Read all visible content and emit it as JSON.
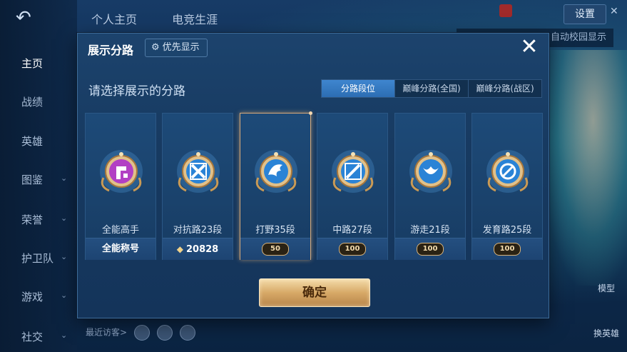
{
  "top_tabs": [
    "个人主页",
    "电竞生涯"
  ],
  "settings_label": "设置",
  "right_banner_text": "自动校园显示",
  "side_nav": [
    {
      "label": "主页",
      "has_chevron": false,
      "active": true
    },
    {
      "label": "战绩",
      "has_chevron": false,
      "active": false
    },
    {
      "label": "英雄",
      "has_chevron": false,
      "active": false
    },
    {
      "label": "图鉴",
      "has_chevron": true,
      "active": false
    },
    {
      "label": "荣誉",
      "has_chevron": true,
      "active": false
    },
    {
      "label": "护卫队",
      "has_chevron": true,
      "active": false
    },
    {
      "label": "游戏",
      "has_chevron": true,
      "active": false
    },
    {
      "label": "社交",
      "has_chevron": true,
      "active": false
    }
  ],
  "right_side": {
    "model_label": "模型",
    "swap_hero_label": "换英雄"
  },
  "bottom_bar": {
    "recent_visitors_label": "最近访客>"
  },
  "modal": {
    "title": "展示分路",
    "priority_btn_label": "优先显示",
    "subtitle": "请选择展示的分路",
    "segments": [
      {
        "label": "分路段位",
        "active": true
      },
      {
        "label": "巅峰分路(全国)",
        "active": false
      },
      {
        "label": "巅峰分路(战区)",
        "active": false
      }
    ],
    "confirm_label": "确定",
    "cards": [
      {
        "label": "全能高手",
        "footer_text": "全能称号",
        "footer_type": "text",
        "selected": false,
        "badge_icon": "all-round-badge-icon",
        "badge_color": "#b23fc4"
      },
      {
        "label": "对抗路23段",
        "footer_text": "20828",
        "footer_type": "points",
        "selected": false,
        "badge_icon": "clash-lane-badge-icon",
        "badge_color": "#2a83d6"
      },
      {
        "label": "打野35段",
        "footer_text": "50",
        "footer_type": "stars",
        "selected": true,
        "badge_icon": "jungle-badge-icon",
        "badge_color": "#2a83d6"
      },
      {
        "label": "中路27段",
        "footer_text": "100",
        "footer_type": "stars",
        "selected": false,
        "badge_icon": "mid-lane-badge-icon",
        "badge_color": "#2a83d6"
      },
      {
        "label": "游走21段",
        "footer_text": "100",
        "footer_type": "stars",
        "selected": false,
        "badge_icon": "roam-badge-icon",
        "badge_color": "#2a83d6"
      },
      {
        "label": "发育路25段",
        "footer_text": "100",
        "footer_type": "stars",
        "selected": false,
        "badge_icon": "farm-lane-badge-icon",
        "badge_color": "#2a83d6"
      }
    ]
  },
  "colors": {
    "accent_blue": "#2c6db3",
    "gold": "#d7a967",
    "modal_bg": "#173a61"
  }
}
